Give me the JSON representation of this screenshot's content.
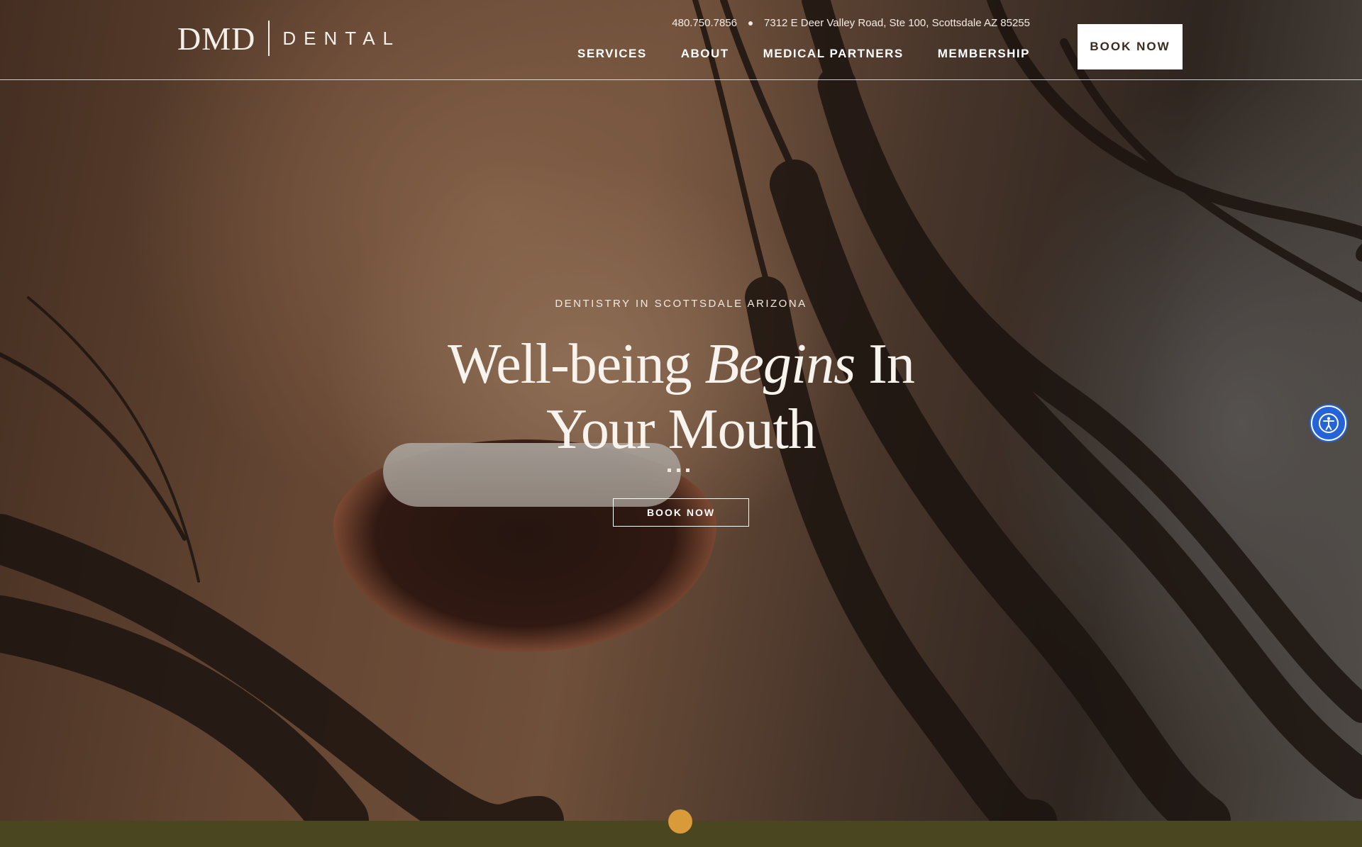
{
  "brand": {
    "logo_primary": "DMD",
    "logo_secondary": "DENTAL"
  },
  "contact": {
    "phone": "480.750.7856",
    "address": "7312 E Deer Valley Road, Ste 100, Scottsdale AZ 85255"
  },
  "nav": [
    {
      "label": "SERVICES"
    },
    {
      "label": "ABOUT"
    },
    {
      "label": "MEDICAL PARTNERS"
    },
    {
      "label": "MEMBERSHIP"
    }
  ],
  "header_cta": "BOOK NOW",
  "hero": {
    "eyebrow": "DENTISTRY IN SCOTTSDALE ARIZONA",
    "headline_part1": "Well-being ",
    "headline_em": "Begins",
    "headline_part2": " In",
    "headline_line2": "Your Mouth",
    "cta": "BOOK NOW"
  },
  "icons": {
    "accessibility": "accessibility-icon"
  },
  "colors": {
    "bottom_band": "#4a4620",
    "scroll_indicator": "#d99a3a",
    "accessibility_button": "#2563d9"
  }
}
